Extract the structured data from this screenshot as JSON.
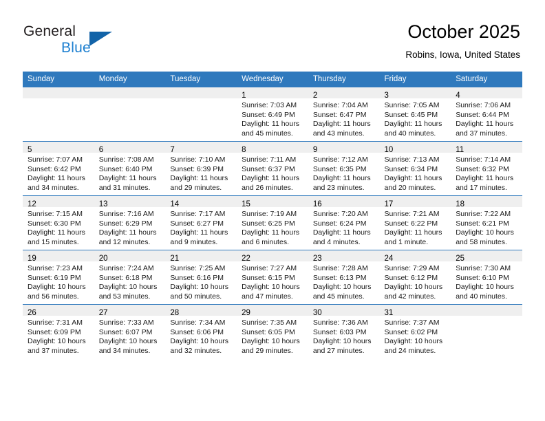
{
  "brand": {
    "name_part1": "General",
    "name_part2": "Blue",
    "accent_color": "#1263a8",
    "blue_text_color": "#1c7fd0"
  },
  "header": {
    "title": "October 2025",
    "location": "Robins, Iowa, United States"
  },
  "theme": {
    "header_row_bg": "#2f79bd",
    "daynum_band_bg": "#efefef",
    "cell_border": "#2f79bd"
  },
  "weekday_headers": [
    "Sunday",
    "Monday",
    "Tuesday",
    "Wednesday",
    "Thursday",
    "Friday",
    "Saturday"
  ],
  "weeks": [
    [
      {
        "day": "",
        "empty": true,
        "sunrise": "",
        "sunset": "",
        "daylight_line1": "",
        "daylight_line2": ""
      },
      {
        "day": "",
        "empty": true,
        "sunrise": "",
        "sunset": "",
        "daylight_line1": "",
        "daylight_line2": ""
      },
      {
        "day": "",
        "empty": true,
        "sunrise": "",
        "sunset": "",
        "daylight_line1": "",
        "daylight_line2": ""
      },
      {
        "day": "1",
        "empty": false,
        "sunrise": "Sunrise: 7:03 AM",
        "sunset": "Sunset: 6:49 PM",
        "daylight_line1": "Daylight: 11 hours",
        "daylight_line2": "and 45 minutes."
      },
      {
        "day": "2",
        "empty": false,
        "sunrise": "Sunrise: 7:04 AM",
        "sunset": "Sunset: 6:47 PM",
        "daylight_line1": "Daylight: 11 hours",
        "daylight_line2": "and 43 minutes."
      },
      {
        "day": "3",
        "empty": false,
        "sunrise": "Sunrise: 7:05 AM",
        "sunset": "Sunset: 6:45 PM",
        "daylight_line1": "Daylight: 11 hours",
        "daylight_line2": "and 40 minutes."
      },
      {
        "day": "4",
        "empty": false,
        "sunrise": "Sunrise: 7:06 AM",
        "sunset": "Sunset: 6:44 PM",
        "daylight_line1": "Daylight: 11 hours",
        "daylight_line2": "and 37 minutes."
      }
    ],
    [
      {
        "day": "5",
        "empty": false,
        "sunrise": "Sunrise: 7:07 AM",
        "sunset": "Sunset: 6:42 PM",
        "daylight_line1": "Daylight: 11 hours",
        "daylight_line2": "and 34 minutes."
      },
      {
        "day": "6",
        "empty": false,
        "sunrise": "Sunrise: 7:08 AM",
        "sunset": "Sunset: 6:40 PM",
        "daylight_line1": "Daylight: 11 hours",
        "daylight_line2": "and 31 minutes."
      },
      {
        "day": "7",
        "empty": false,
        "sunrise": "Sunrise: 7:10 AM",
        "sunset": "Sunset: 6:39 PM",
        "daylight_line1": "Daylight: 11 hours",
        "daylight_line2": "and 29 minutes."
      },
      {
        "day": "8",
        "empty": false,
        "sunrise": "Sunrise: 7:11 AM",
        "sunset": "Sunset: 6:37 PM",
        "daylight_line1": "Daylight: 11 hours",
        "daylight_line2": "and 26 minutes."
      },
      {
        "day": "9",
        "empty": false,
        "sunrise": "Sunrise: 7:12 AM",
        "sunset": "Sunset: 6:35 PM",
        "daylight_line1": "Daylight: 11 hours",
        "daylight_line2": "and 23 minutes."
      },
      {
        "day": "10",
        "empty": false,
        "sunrise": "Sunrise: 7:13 AM",
        "sunset": "Sunset: 6:34 PM",
        "daylight_line1": "Daylight: 11 hours",
        "daylight_line2": "and 20 minutes."
      },
      {
        "day": "11",
        "empty": false,
        "sunrise": "Sunrise: 7:14 AM",
        "sunset": "Sunset: 6:32 PM",
        "daylight_line1": "Daylight: 11 hours",
        "daylight_line2": "and 17 minutes."
      }
    ],
    [
      {
        "day": "12",
        "empty": false,
        "sunrise": "Sunrise: 7:15 AM",
        "sunset": "Sunset: 6:30 PM",
        "daylight_line1": "Daylight: 11 hours",
        "daylight_line2": "and 15 minutes."
      },
      {
        "day": "13",
        "empty": false,
        "sunrise": "Sunrise: 7:16 AM",
        "sunset": "Sunset: 6:29 PM",
        "daylight_line1": "Daylight: 11 hours",
        "daylight_line2": "and 12 minutes."
      },
      {
        "day": "14",
        "empty": false,
        "sunrise": "Sunrise: 7:17 AM",
        "sunset": "Sunset: 6:27 PM",
        "daylight_line1": "Daylight: 11 hours",
        "daylight_line2": "and 9 minutes."
      },
      {
        "day": "15",
        "empty": false,
        "sunrise": "Sunrise: 7:19 AM",
        "sunset": "Sunset: 6:25 PM",
        "daylight_line1": "Daylight: 11 hours",
        "daylight_line2": "and 6 minutes."
      },
      {
        "day": "16",
        "empty": false,
        "sunrise": "Sunrise: 7:20 AM",
        "sunset": "Sunset: 6:24 PM",
        "daylight_line1": "Daylight: 11 hours",
        "daylight_line2": "and 4 minutes."
      },
      {
        "day": "17",
        "empty": false,
        "sunrise": "Sunrise: 7:21 AM",
        "sunset": "Sunset: 6:22 PM",
        "daylight_line1": "Daylight: 11 hours",
        "daylight_line2": "and 1 minute."
      },
      {
        "day": "18",
        "empty": false,
        "sunrise": "Sunrise: 7:22 AM",
        "sunset": "Sunset: 6:21 PM",
        "daylight_line1": "Daylight: 10 hours",
        "daylight_line2": "and 58 minutes."
      }
    ],
    [
      {
        "day": "19",
        "empty": false,
        "sunrise": "Sunrise: 7:23 AM",
        "sunset": "Sunset: 6:19 PM",
        "daylight_line1": "Daylight: 10 hours",
        "daylight_line2": "and 56 minutes."
      },
      {
        "day": "20",
        "empty": false,
        "sunrise": "Sunrise: 7:24 AM",
        "sunset": "Sunset: 6:18 PM",
        "daylight_line1": "Daylight: 10 hours",
        "daylight_line2": "and 53 minutes."
      },
      {
        "day": "21",
        "empty": false,
        "sunrise": "Sunrise: 7:25 AM",
        "sunset": "Sunset: 6:16 PM",
        "daylight_line1": "Daylight: 10 hours",
        "daylight_line2": "and 50 minutes."
      },
      {
        "day": "22",
        "empty": false,
        "sunrise": "Sunrise: 7:27 AM",
        "sunset": "Sunset: 6:15 PM",
        "daylight_line1": "Daylight: 10 hours",
        "daylight_line2": "and 47 minutes."
      },
      {
        "day": "23",
        "empty": false,
        "sunrise": "Sunrise: 7:28 AM",
        "sunset": "Sunset: 6:13 PM",
        "daylight_line1": "Daylight: 10 hours",
        "daylight_line2": "and 45 minutes."
      },
      {
        "day": "24",
        "empty": false,
        "sunrise": "Sunrise: 7:29 AM",
        "sunset": "Sunset: 6:12 PM",
        "daylight_line1": "Daylight: 10 hours",
        "daylight_line2": "and 42 minutes."
      },
      {
        "day": "25",
        "empty": false,
        "sunrise": "Sunrise: 7:30 AM",
        "sunset": "Sunset: 6:10 PM",
        "daylight_line1": "Daylight: 10 hours",
        "daylight_line2": "and 40 minutes."
      }
    ],
    [
      {
        "day": "26",
        "empty": false,
        "sunrise": "Sunrise: 7:31 AM",
        "sunset": "Sunset: 6:09 PM",
        "daylight_line1": "Daylight: 10 hours",
        "daylight_line2": "and 37 minutes."
      },
      {
        "day": "27",
        "empty": false,
        "sunrise": "Sunrise: 7:33 AM",
        "sunset": "Sunset: 6:07 PM",
        "daylight_line1": "Daylight: 10 hours",
        "daylight_line2": "and 34 minutes."
      },
      {
        "day": "28",
        "empty": false,
        "sunrise": "Sunrise: 7:34 AM",
        "sunset": "Sunset: 6:06 PM",
        "daylight_line1": "Daylight: 10 hours",
        "daylight_line2": "and 32 minutes."
      },
      {
        "day": "29",
        "empty": false,
        "sunrise": "Sunrise: 7:35 AM",
        "sunset": "Sunset: 6:05 PM",
        "daylight_line1": "Daylight: 10 hours",
        "daylight_line2": "and 29 minutes."
      },
      {
        "day": "30",
        "empty": false,
        "sunrise": "Sunrise: 7:36 AM",
        "sunset": "Sunset: 6:03 PM",
        "daylight_line1": "Daylight: 10 hours",
        "daylight_line2": "and 27 minutes."
      },
      {
        "day": "31",
        "empty": false,
        "sunrise": "Sunrise: 7:37 AM",
        "sunset": "Sunset: 6:02 PM",
        "daylight_line1": "Daylight: 10 hours",
        "daylight_line2": "and 24 minutes."
      },
      {
        "day": "",
        "empty": true,
        "sunrise": "",
        "sunset": "",
        "daylight_line1": "",
        "daylight_line2": ""
      }
    ]
  ]
}
